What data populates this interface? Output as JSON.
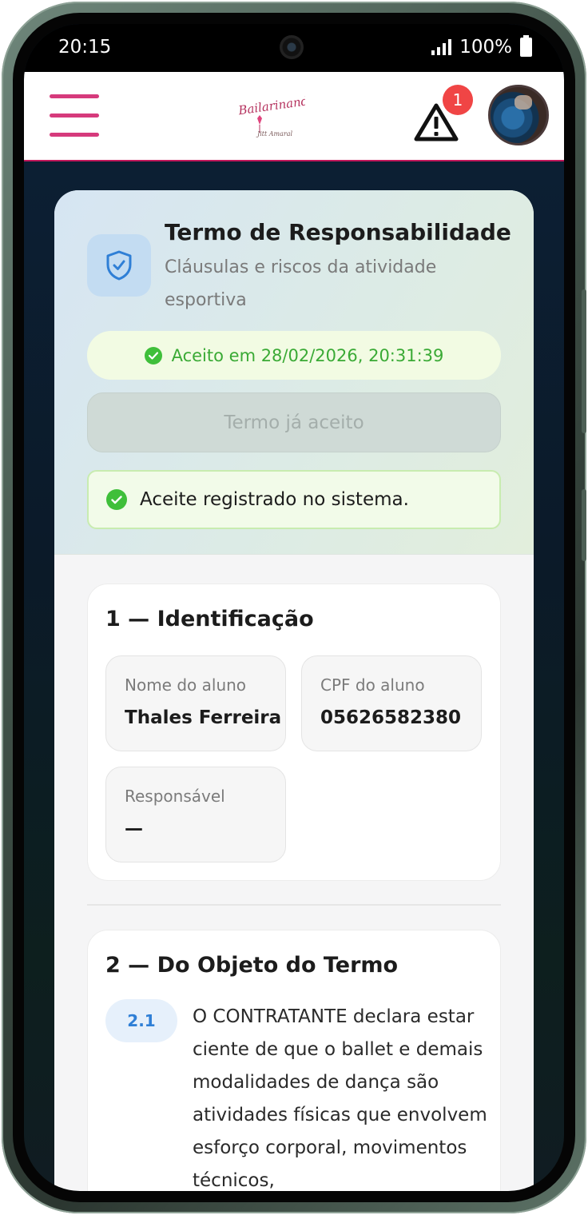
{
  "status_bar": {
    "time": "20:15",
    "battery": "100%"
  },
  "header": {
    "logo_text": "Bailarinando",
    "logo_subtext": "Jitt Amaral",
    "alert_count": "1"
  },
  "card": {
    "title": "Termo de Responsabilidade",
    "subtitle": "Cláusulas e riscos da atividade esportiva",
    "accepted_status": "Aceito em 28/02/2026, 20:31:39",
    "accept_button": "Termo já aceito",
    "registered_message": "Aceite registrado no sistema."
  },
  "section1": {
    "title": "1 — Identificação",
    "fields": [
      {
        "label": "Nome do aluno",
        "value": "Thales Ferreira"
      },
      {
        "label": "CPF do aluno",
        "value": "05626582380"
      },
      {
        "label": "Responsável",
        "value": "—"
      }
    ]
  },
  "section2": {
    "title": "2 — Do Objeto do Termo",
    "clause_number": "2.1",
    "clause_text": "O CONTRATANTE declara estar ciente de que o ballet e demais modalidades de dança são atividades físicas que envolvem esforço corporal, movimentos técnicos,"
  },
  "colors": {
    "accent": "#d63a7c",
    "success": "#3fbf3a",
    "info": "#2f7fd6",
    "badge": "#f04545"
  }
}
